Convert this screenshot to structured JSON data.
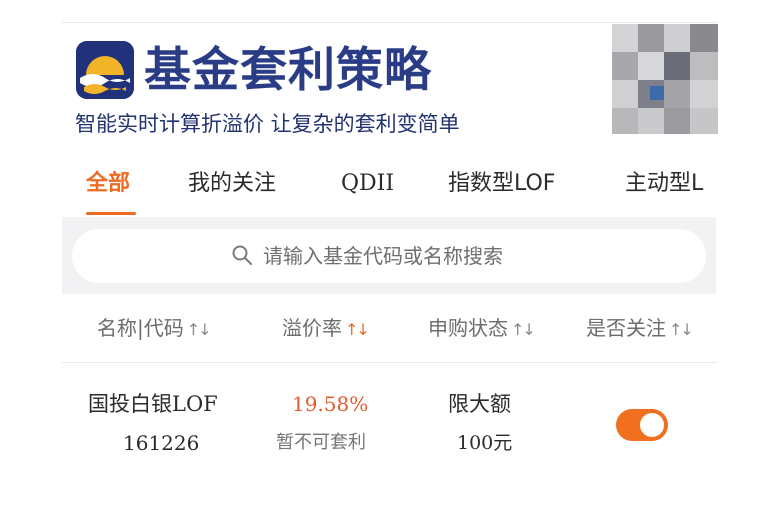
{
  "header": {
    "app_title": "基金套利策略",
    "slogan": "智能实时计算折溢价 让复杂的套利变简单",
    "logo_icon": "sunrise-over-water-logo",
    "qr_icon": "qr-code-icon"
  },
  "tabs": [
    {
      "label": "全部",
      "active": true
    },
    {
      "label": "我的关注",
      "active": false
    },
    {
      "label": "QDII",
      "active": false
    },
    {
      "label": "指数型LOF",
      "active": false
    },
    {
      "label": "主动型L",
      "active": false
    }
  ],
  "search": {
    "placeholder": "请输入基金代码或名称搜索",
    "icon": "search-icon"
  },
  "table": {
    "headers": [
      {
        "label": "名称|代码",
        "sort_active": false
      },
      {
        "label": "溢价率",
        "sort_active": true
      },
      {
        "label": "申购状态",
        "sort_active": false
      },
      {
        "label": "是否关注",
        "sort_active": false
      }
    ],
    "rows": [
      {
        "name": "国投白银LOF",
        "code": "161226",
        "premium": "19.58%",
        "arbitrage_status": "暂不可套利",
        "purchase_status": "限大额",
        "purchase_limit": "100元",
        "followed": true
      }
    ]
  },
  "colors": {
    "accent": "#ef6a22",
    "brand_navy": "#21317a",
    "premium_red": "#e25b2c"
  }
}
